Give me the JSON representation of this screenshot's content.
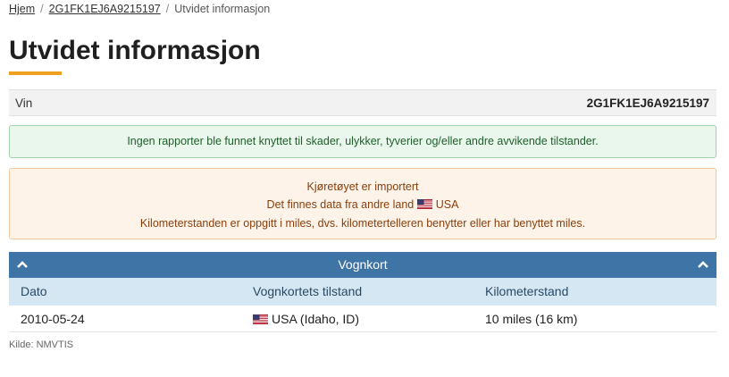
{
  "breadcrumb": {
    "home": "Hjem",
    "vin_link": "2G1FK1EJ6A9215197",
    "current": "Utvidet informasjon",
    "separator": "/"
  },
  "page": {
    "title": "Utvidet informasjon"
  },
  "vin": {
    "label": "Vin",
    "value": "2G1FK1EJ6A9215197"
  },
  "alerts": {
    "success": "Ingen rapporter ble funnet knyttet til skader, ulykker, tyverier og/eller andre avvikende tilstander.",
    "warning": {
      "line1": "Kjøretøyet er importert",
      "line2_prefix": "Det finnes data fra andre land",
      "line2_country": "USA",
      "line3": "Kilometerstanden er oppgitt i miles, dvs. kilometertelleren benytter eller har benyttet miles."
    }
  },
  "registration": {
    "title": "Vognkort",
    "columns": [
      "Dato",
      "Vognkortets tilstand",
      "Kilometerstand"
    ],
    "rows": [
      {
        "date": "2010-05-24",
        "state": "USA (Idaho, ID)",
        "mileage": "10 miles (16 km)",
        "flag": "us-flag-icon"
      }
    ]
  },
  "source": "Kilde: NMVTIS",
  "colors": {
    "accent": "#f0a020",
    "panel_header": "#3f75a6",
    "table_header": "#d4e7f3",
    "success_bg": "#e9f7ec",
    "warning_bg": "#fdf3e8"
  }
}
